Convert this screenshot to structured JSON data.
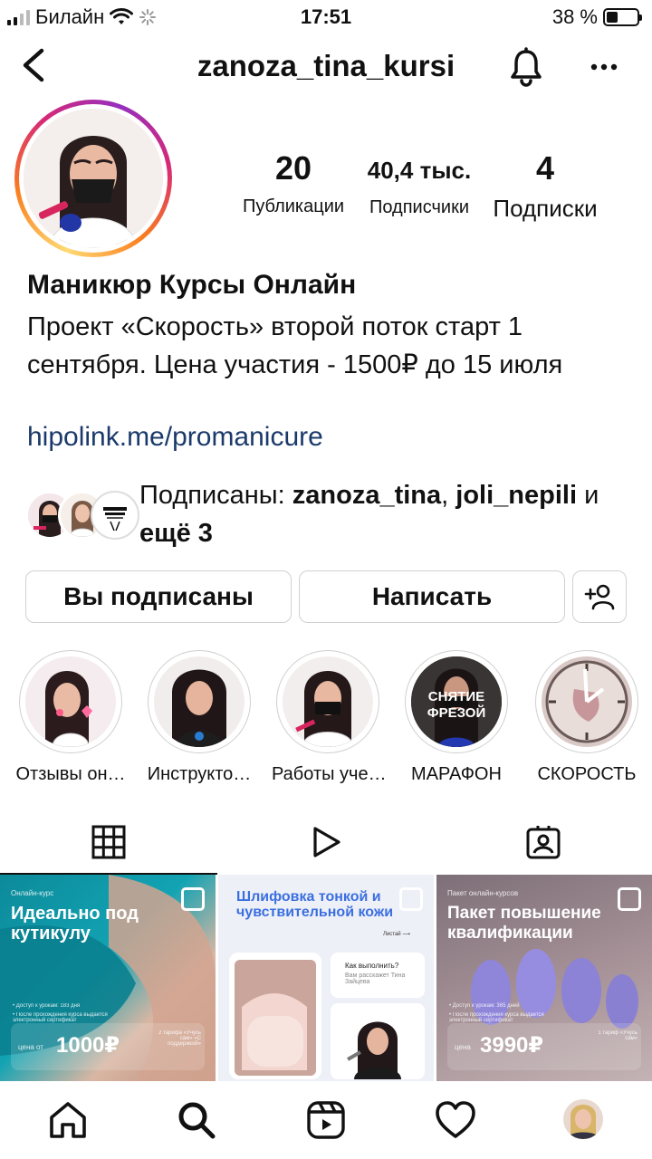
{
  "status_bar": {
    "carrier": "Билайн",
    "time": "17:51",
    "battery": "38 %",
    "battery_level": 0.38
  },
  "header": {
    "username": "zanoza_tina_kursi",
    "icons": [
      "back-icon",
      "bell-icon",
      "more-icon"
    ]
  },
  "stats": {
    "posts_count": "20",
    "posts_label": "Публикации",
    "followers_count": "40,4 тыс.",
    "followers_label": "Подписчики",
    "following_count": "4",
    "following_label": "Подписки"
  },
  "bio": {
    "name": "Маникюр Курсы Онлайн",
    "text": "Проект «Скорость» второй поток старт 1 сентября. Цена участия - 1500₽ до 15 июля",
    "link": "hipolink.me/promanicure"
  },
  "followed_by": {
    "prefix": "Подписаны: ",
    "user1": "zanoza_tina",
    "separator": ", ",
    "user2": "joli_nepili",
    "suffix_and": " и ",
    "suffix_more": "ещё 3"
  },
  "actions": {
    "following_btn": "Вы подписаны",
    "message_btn": "Написать"
  },
  "highlights": [
    {
      "label": "Отзывы он…"
    },
    {
      "label": "Инструкто…"
    },
    {
      "label": "Работы уче…"
    },
    {
      "label": "МАРАФОН",
      "cover_text": "СНЯТИЕ ФРЕЗОЙ"
    },
    {
      "label": "СКОРОСТЬ"
    }
  ],
  "posts": [
    {
      "top_small": "Онлайн-курс",
      "title": "Идеально под кутикулу",
      "info1": "• Доступ к урокам: 183 дня",
      "info2": "• После прохождения курса выдается электронный сертификат",
      "price_prefix": "цена от",
      "price": "1000₽",
      "tariffs": "2 тарифа «Учусь сам» «С поддержкой»"
    },
    {
      "title": "Шлифовка тонкой и чувствительной кожи",
      "read_more": "Листай ⟶",
      "question": "Как выполнить?",
      "answer": "Вам расскажет Тина Зайцева"
    },
    {
      "top_small": "Пакет онлайн-курсов",
      "title": "Пакет повышение квалификации",
      "info1": "• Доступ к урокам: 365 дней",
      "info2": "• После прохождения курса выдается электронный сертификат",
      "price_prefix": "цена",
      "price": "3990₽",
      "tariffs": "1 тариф «Учусь сам»"
    }
  ],
  "colors": {
    "link": "#1b3a6b",
    "ring_gradient": [
      "#feda75",
      "#fa7e1e",
      "#d62976",
      "#962fbf"
    ],
    "post1_bg": "#0e8fa0",
    "post3_bg": "#8e7c86"
  }
}
